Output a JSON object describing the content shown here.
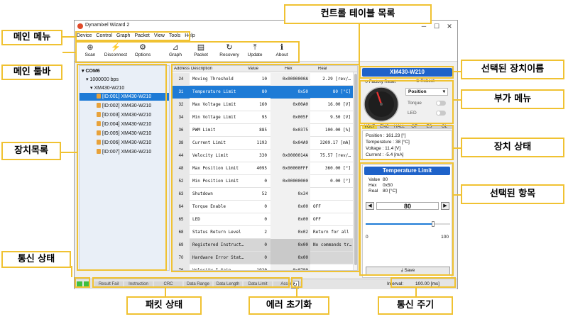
{
  "window": {
    "title": "Dynamixel Wizard 2",
    "controls": [
      "─",
      "☐",
      "✕"
    ]
  },
  "menu": [
    "Device",
    "Control",
    "Graph",
    "Packet",
    "View",
    "Tools",
    "Help"
  ],
  "toolbar": [
    {
      "label": "Scan",
      "icon": "scan-icon",
      "glyph": "⊕"
    },
    {
      "label": "Disconnect",
      "icon": "disconnect-icon",
      "glyph": "⚡"
    },
    {
      "label": "Options",
      "icon": "gear-icon",
      "glyph": "⚙"
    },
    {
      "label": "Graph",
      "icon": "graph-icon",
      "glyph": "⊿"
    },
    {
      "label": "Packet",
      "icon": "packet-icon",
      "glyph": "▤"
    },
    {
      "label": "Recovery",
      "icon": "recovery-icon",
      "glyph": "↻"
    },
    {
      "label": "Update",
      "icon": "update-icon",
      "glyph": "⤒"
    },
    {
      "label": "About",
      "icon": "info-icon",
      "glyph": "ℹ"
    }
  ],
  "tree": {
    "port": "COM6",
    "baud": "1000000 bps",
    "model": "XM430-W210",
    "devices": [
      "[ID:001] XM430-W210",
      "[ID:002] XM430-W210",
      "[ID:003] XM430-W210",
      "[ID:004] XM430-W210",
      "[ID:005] XM430-W210",
      "[ID:006] XM430-W210",
      "[ID:007] XM430-W210"
    ]
  },
  "table": {
    "headers": [
      "Address",
      "Description",
      "Value",
      "Hex",
      "Real"
    ],
    "rows": [
      {
        "addr": "24",
        "desc": "Moving Threshold",
        "value": "10",
        "hex": "0x0000000A",
        "real": "2.29 [rev/…"
      },
      {
        "addr": "31",
        "desc": "Temperature Limit",
        "value": "80",
        "hex": "0x50",
        "real": "80 [°C]"
      },
      {
        "addr": "32",
        "desc": "Max Voltage Limit",
        "value": "160",
        "hex": "0x00A0",
        "real": "16.00 [V]"
      },
      {
        "addr": "34",
        "desc": "Min Voltage Limit",
        "value": "95",
        "hex": "0x005F",
        "real": "9.50 [V]"
      },
      {
        "addr": "36",
        "desc": "PWM Limit",
        "value": "885",
        "hex": "0x0375",
        "real": "100.00 [%]"
      },
      {
        "addr": "38",
        "desc": "Current Limit",
        "value": "1193",
        "hex": "0x04A9",
        "real": "3209.17 [mA]"
      },
      {
        "addr": "44",
        "desc": "Velocity Limit",
        "value": "330",
        "hex": "0x0000014A",
        "real": "75.57 [rev/…"
      },
      {
        "addr": "48",
        "desc": "Max Position Limit",
        "value": "4095",
        "hex": "0x00000FFF",
        "real": "360.00 [°]"
      },
      {
        "addr": "52",
        "desc": "Min Position Limit",
        "value": "0",
        "hex": "0x00000000",
        "real": "0.00 [°]"
      },
      {
        "addr": "63",
        "desc": "Shutdown",
        "value": "52",
        "hex": "0x34",
        "real": ""
      },
      {
        "addr": "64",
        "desc": "Torque Enable",
        "value": "0",
        "hex": "0x00",
        "real": "OFF"
      },
      {
        "addr": "65",
        "desc": "LED",
        "value": "0",
        "hex": "0x00",
        "real": "OFF"
      },
      {
        "addr": "68",
        "desc": "Status Return Level",
        "value": "2",
        "hex": "0x02",
        "real": "Return for all"
      },
      {
        "addr": "69",
        "desc": "Registered Instruct…",
        "value": "0",
        "hex": "0x00",
        "real": "No commands tr…"
      },
      {
        "addr": "70",
        "desc": "Hardware Error Stat…",
        "value": "0",
        "hex": "0x00",
        "real": ""
      },
      {
        "addr": "76",
        "desc": "Velocity I Gain",
        "value": "1920",
        "hex": "0x0780",
        "real": ""
      }
    ]
  },
  "device_panel": {
    "name": "XM430-W210",
    "factory_reset": "Factory Reset",
    "reboot": "Reboot",
    "mode": "Position",
    "torque_label": "Torque",
    "led_label": "LED",
    "status_flags": [
      "VOLT",
      "ENC",
      "HALL",
      "OT",
      "ES",
      "OL"
    ],
    "status_lines": [
      "Position : 161.23 [°]",
      "Temperature : 38 [°C]",
      "Voltage : 11.4 [V]",
      "Current : -5.4 [mA]"
    ],
    "dial_angle_deg": 161.23
  },
  "item_panel": {
    "title": "Temperature Limit",
    "value_label": "Value",
    "value": "80",
    "hex_label": "Hex",
    "hex": "0x50",
    "real_label": "Real",
    "real": "80 [°C]",
    "input_value": "80",
    "slider_min": "0",
    "slider_max": "100",
    "slider_fraction": 0.8,
    "save_label": "Save"
  },
  "statusbar": {
    "items": [
      "Result Fail",
      "Instruction",
      "CRC",
      "Data Range",
      "Data Length",
      "Data Limit",
      "Access"
    ],
    "interval_label": "Interval:",
    "interval_value": "100.00 [ms]"
  },
  "annotations": {
    "main_menu": "메인 메뉴",
    "main_toolbar": "메인 툴바",
    "device_list": "장치목록",
    "comm_status": "통신 상태",
    "packet_status": "패킷 상태",
    "error_reset": "에러 초기화",
    "comm_period": "통신 주기",
    "control_table": "컨트롤 테이블 목록",
    "selected_device": "선택된 장치이름",
    "extra_menu": "부가 메뉴",
    "device_status": "장치 상태",
    "selected_item": "선택된 항목"
  },
  "colors": {
    "accent": "#1e62c9",
    "selection": "#1e7bd6",
    "annotation": "#f0c232"
  }
}
